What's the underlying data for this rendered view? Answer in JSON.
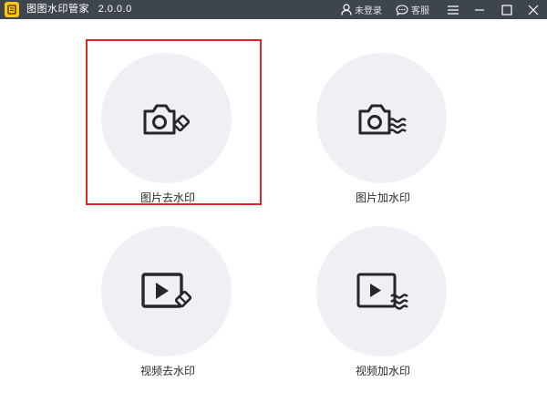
{
  "app": {
    "title": "图图水印管家",
    "version": "2.0.0.0"
  },
  "titlebar": {
    "login_label": "未登录",
    "service_label": "客服",
    "icons": [
      "user-icon",
      "chat-icon",
      "menu-icon",
      "minimize-icon",
      "maximize-icon",
      "close-icon"
    ]
  },
  "features": [
    {
      "label": "图片去水印",
      "icon": "camera-eraser-icon",
      "selected": true
    },
    {
      "label": "图片加水印",
      "icon": "camera-wave-icon",
      "selected": false
    },
    {
      "label": "视频去水印",
      "icon": "video-eraser-icon",
      "selected": false
    },
    {
      "label": "视频加水印",
      "icon": "video-wave-icon",
      "selected": false
    }
  ],
  "colors": {
    "titlebar": "#3f454d",
    "circle": "#eef0f5",
    "selection": "#e0262c",
    "logo": "#ffc414"
  }
}
